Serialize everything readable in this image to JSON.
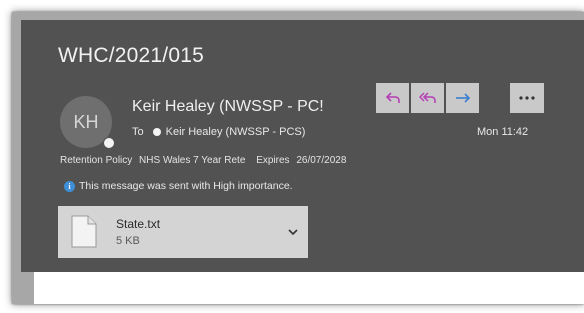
{
  "message": {
    "subject": "WHC/2021/015",
    "sender": {
      "initials": "KH",
      "name": "Keir Healey (NWSSP - PC!"
    },
    "to_label": "To",
    "recipient": "Keir Healey (NWSSP - PCS)",
    "date": "Mon 11:42",
    "retention": {
      "label": "Retention Policy",
      "value": "NHS Wales 7 Year Rete",
      "expires_label": "Expires",
      "expires_value": "26/07/2028"
    },
    "importance_text": "This message was sent with High importance.",
    "attachment": {
      "name": "State.txt",
      "size": "5 KB"
    }
  },
  "actions": {
    "reply_icon": "reply-icon",
    "reply_all_icon": "reply-all-icon",
    "forward_icon": "forward-icon",
    "more_icon": "more-options-icon"
  },
  "colors": {
    "panel": "#525252",
    "button": "#c9c9c9",
    "reply_accent": "#b43fb4",
    "forward_accent": "#3b7fd1",
    "info": "#3f8fd6"
  }
}
